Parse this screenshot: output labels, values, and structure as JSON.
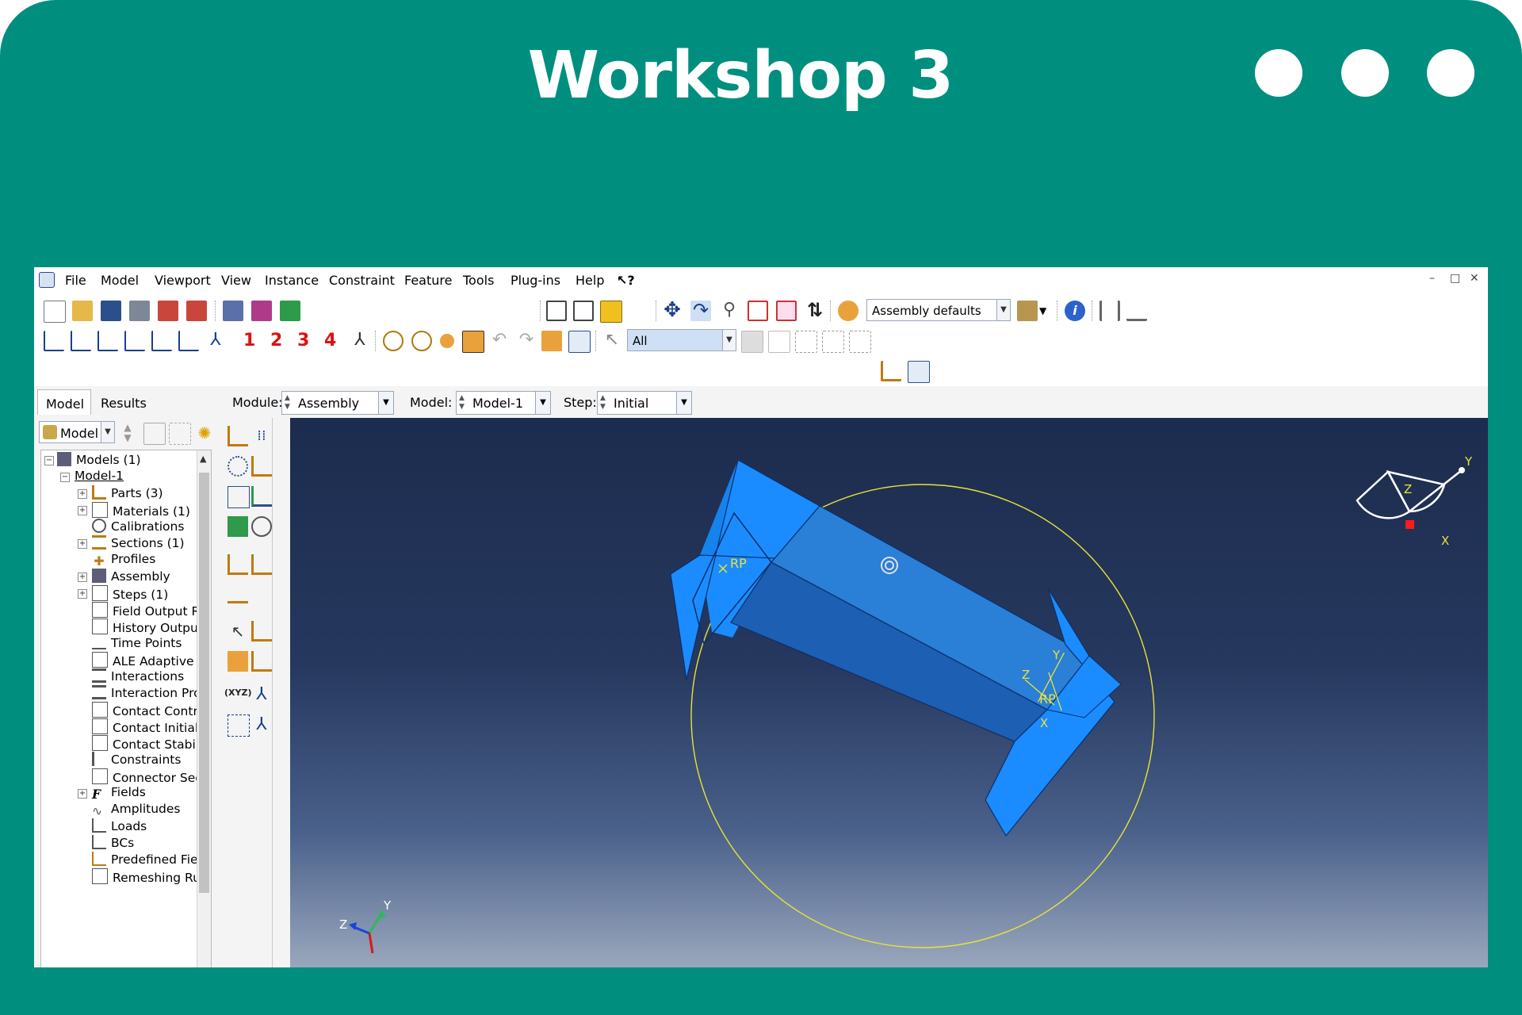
{
  "slide": {
    "title": "Workshop 3"
  },
  "menu": {
    "items": [
      "File",
      "Model",
      "Viewport",
      "View",
      "Instance",
      "Constraint",
      "Feature",
      "Tools",
      "Plug-ins",
      "Help"
    ],
    "whatsthis": "↖?",
    "window_controls": [
      "–",
      "□",
      "✕"
    ]
  },
  "toolbar": {
    "render_style": "Assembly defaults",
    "numbers": [
      "1",
      "2",
      "3",
      "4"
    ],
    "selection_filter": "All"
  },
  "context": {
    "module_label": "Module:",
    "module_value": "Assembly",
    "model_label": "Model:",
    "model_value": "Model-1",
    "step_label": "Step:",
    "step_value": "Initial"
  },
  "tree": {
    "tabs": [
      "Model",
      "Results"
    ],
    "selector": "Model",
    "items": [
      "Models (1)",
      "Model-1",
      "Parts (3)",
      "Materials (1)",
      "Calibrations",
      "Sections (1)",
      "Profiles",
      "Assembly",
      "Steps (1)",
      "Field Output Re",
      "History Output",
      "Time Points",
      "ALE Adaptive M",
      "Interactions",
      "Interaction Pro",
      "Contact Contro",
      "Contact Initializ",
      "Contact Stabiliz",
      "Constraints",
      "Connector Secti",
      "Fields",
      "Amplitudes",
      "Loads",
      "BCs",
      "Predefined Fiel",
      "Remeshing Rul"
    ]
  },
  "viewport": {
    "rp_label": "RP",
    "triad": {
      "x": "X",
      "y": "Y",
      "z": "Z"
    },
    "view_cube": {
      "x": "X",
      "y": "Y",
      "z": "Z"
    }
  },
  "colors": {
    "frame": "#008f7e",
    "part": "#1a8cff",
    "sphere": "#e8e23a"
  }
}
